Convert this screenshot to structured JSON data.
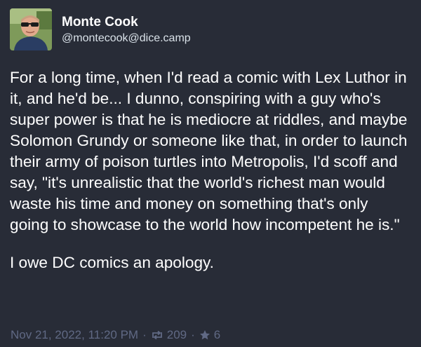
{
  "author": {
    "display_name": "Monte Cook",
    "handle": "@montecook@dice.camp"
  },
  "post": {
    "paragraphs": [
      "For a long time, when I'd read a comic with Lex Luthor in it, and he'd be... I dunno, conspiring with a guy who's super power is that he is mediocre at riddles, and maybe Solomon Grundy or someone like that, in order to launch their army of poison turtles into Metropolis, I'd scoff and say, \"it's unrealistic that the world's richest man would waste his time and money on something that's only going to showcase to the world how incompetent he is.\"",
      "I owe DC comics an apology."
    ],
    "timestamp": "Nov 21, 2022, 11:20 PM",
    "separator": "·",
    "boosts": "209",
    "favourites": "6"
  },
  "icons": {
    "boost": "retweet-icon",
    "favourite": "star-icon"
  },
  "colors": {
    "background": "#282c37",
    "text": "#ffffff",
    "muted": "#606984"
  }
}
